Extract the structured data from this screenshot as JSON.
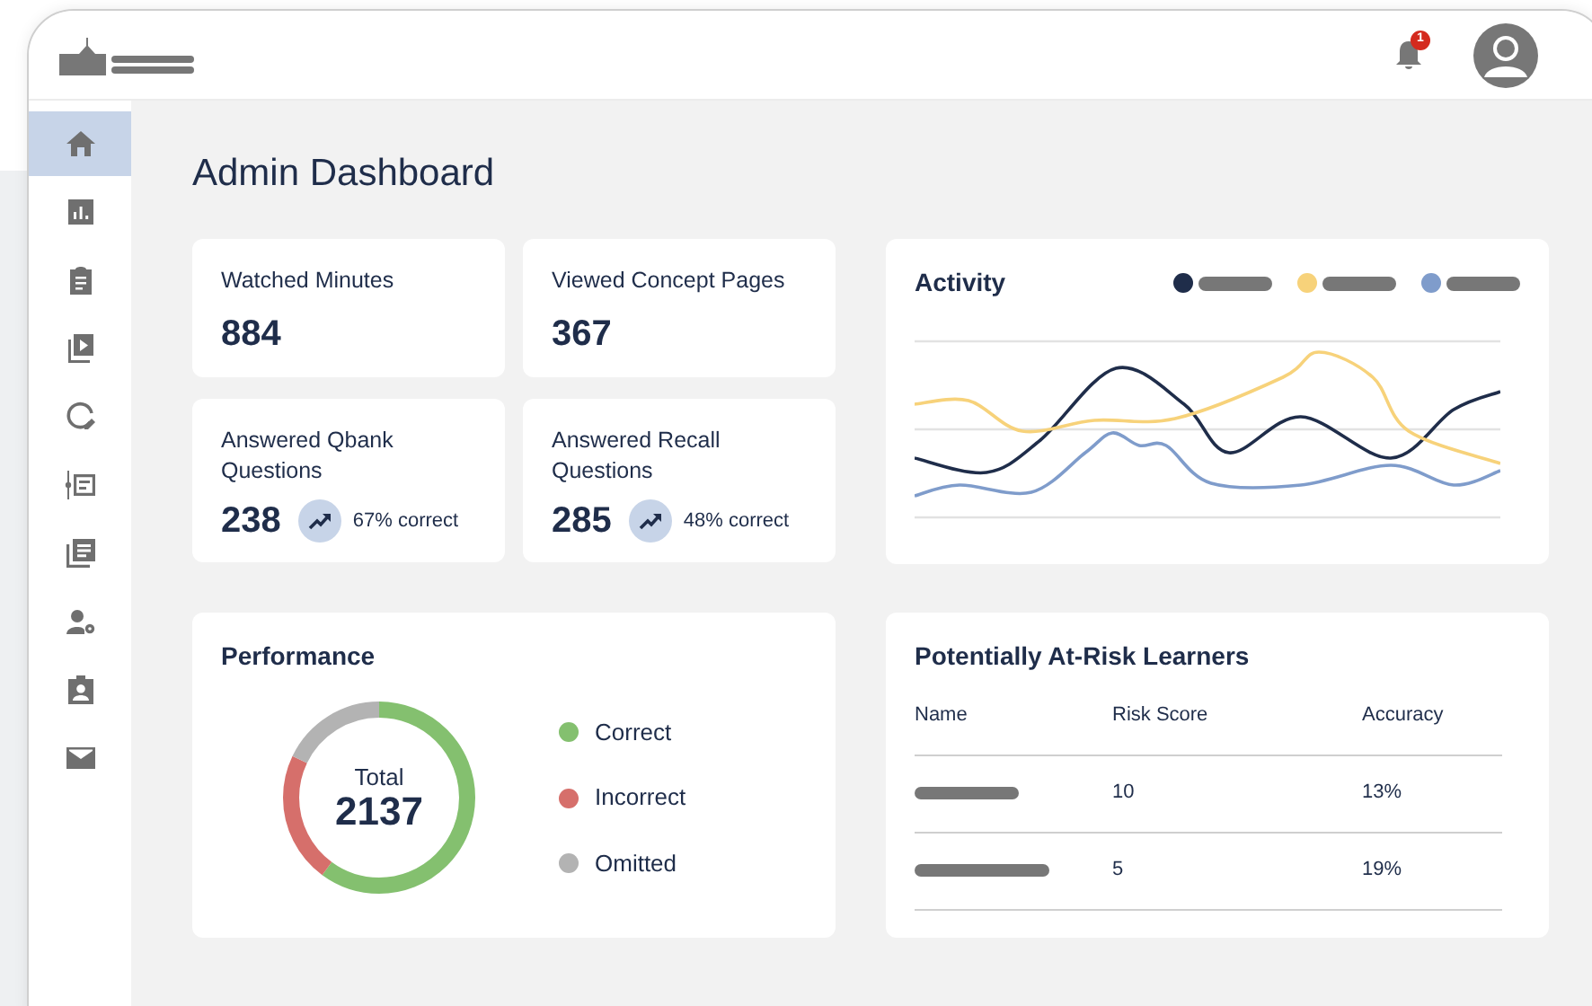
{
  "header": {
    "notification_count": "1"
  },
  "sidebar": {
    "items": [
      {
        "kind": "home",
        "selected": true
      },
      {
        "kind": "chart",
        "selected": false
      },
      {
        "kind": "clipboard",
        "selected": false
      },
      {
        "kind": "video",
        "selected": false
      },
      {
        "kind": "quiz",
        "selected": false
      },
      {
        "kind": "list",
        "selected": false
      },
      {
        "kind": "library",
        "selected": false
      },
      {
        "kind": "user-settings",
        "selected": false
      },
      {
        "kind": "badge",
        "selected": false
      },
      {
        "kind": "mail",
        "selected": false
      }
    ]
  },
  "page_title": "Admin Dashboard",
  "stats": [
    {
      "label": "Watched Minutes",
      "value": "884"
    },
    {
      "label": "Viewed Concept Pages",
      "value": "367"
    },
    {
      "label": "Answered Qbank Questions",
      "value": "238",
      "trend": "67% correct"
    },
    {
      "label": "Answered Recall Questions",
      "value": "285",
      "trend": "48% correct"
    }
  ],
  "activity": {
    "title": "Activity",
    "legend": [
      {
        "color": "#1f2d4a"
      },
      {
        "color": "#f7d27a"
      },
      {
        "color": "#7f9ccb"
      }
    ]
  },
  "performance": {
    "title": "Performance",
    "total_label": "Total",
    "total": "2137",
    "legend": [
      {
        "label": "Correct",
        "color": "#84c06f"
      },
      {
        "label": "Incorrect",
        "color": "#d66f6b"
      },
      {
        "label": "Omitted",
        "color": "#b3b3b3"
      }
    ]
  },
  "at_risk": {
    "title": "Potentially At-Risk Learners",
    "columns": [
      "Name",
      "Risk Score",
      "Accuracy"
    ],
    "rows": [
      {
        "risk_score": "10",
        "accuracy": "13%"
      },
      {
        "risk_score": "5",
        "accuracy": "19%"
      }
    ]
  }
}
